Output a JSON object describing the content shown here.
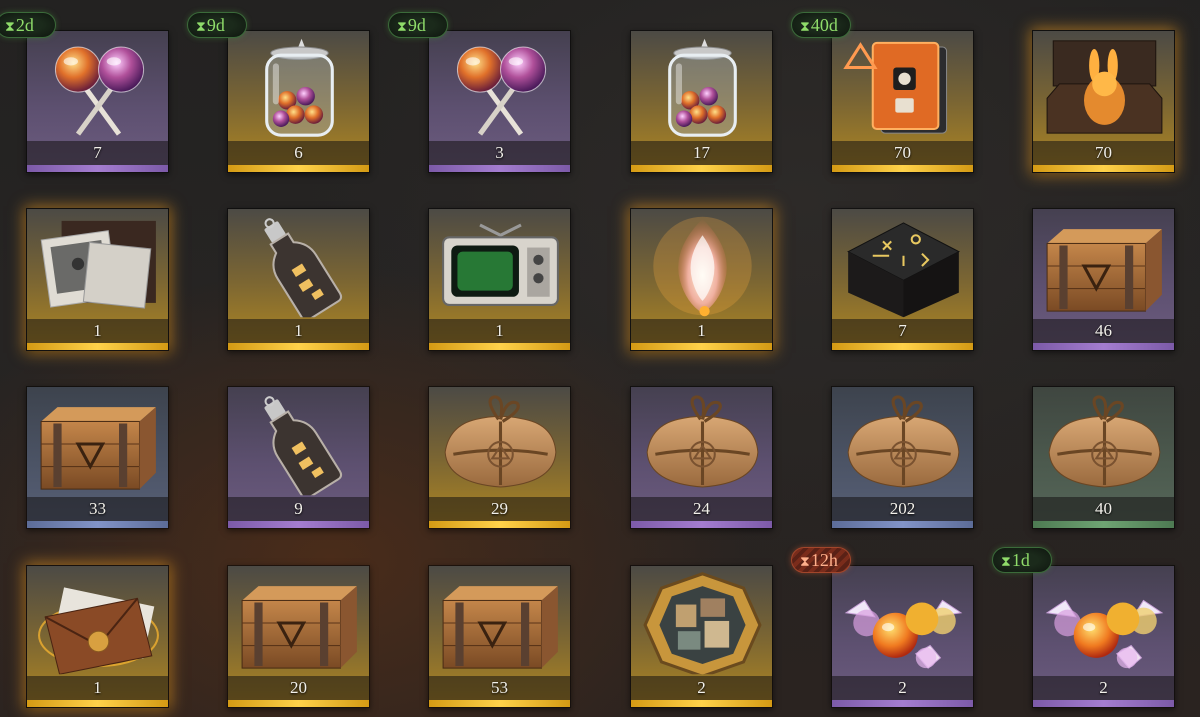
{
  "inventory": {
    "items": [
      {
        "quantity": "7",
        "rarity": "purple",
        "icon": "lollipop-pair-icon"
      },
      {
        "quantity": "6",
        "rarity": "gold",
        "icon": "candy-jar-icon",
        "timer": "9d"
      },
      {
        "quantity": "3",
        "rarity": "purple",
        "icon": "lollipop-pair-icon",
        "timer": "9d"
      },
      {
        "quantity": "17",
        "rarity": "gold",
        "icon": "candy-jar-icon"
      },
      {
        "quantity": "70",
        "rarity": "gold",
        "icon": "rune-tome-icon",
        "timer": "40d"
      },
      {
        "quantity": "70",
        "rarity": "gold",
        "icon": "rabbit-figurine-box-icon"
      },
      {
        "quantity": "1",
        "rarity": "gold",
        "icon": "photo-box-icon"
      },
      {
        "quantity": "1",
        "rarity": "gold",
        "icon": "message-bottle-icon"
      },
      {
        "quantity": "1",
        "rarity": "gold",
        "icon": "retro-tv-icon"
      },
      {
        "quantity": "1",
        "rarity": "gold",
        "icon": "spirit-flame-icon"
      },
      {
        "quantity": "7",
        "rarity": "gold",
        "icon": "rune-altar-icon"
      },
      {
        "quantity": "46",
        "rarity": "purple",
        "icon": "wooden-crate-icon"
      },
      {
        "quantity": "33",
        "rarity": "blue",
        "icon": "wooden-crate-icon"
      },
      {
        "quantity": "9",
        "rarity": "purple",
        "icon": "message-bottle-icon"
      },
      {
        "quantity": "29",
        "rarity": "gold",
        "icon": "paper-parcel-icon"
      },
      {
        "quantity": "24",
        "rarity": "purple",
        "icon": "paper-parcel-icon"
      },
      {
        "quantity": "202",
        "rarity": "blue",
        "icon": "paper-parcel-icon"
      },
      {
        "quantity": "40",
        "rarity": "green",
        "icon": "paper-parcel-icon"
      },
      {
        "quantity": "1",
        "rarity": "gold",
        "icon": "sealed-envelope-icon"
      },
      {
        "quantity": "20",
        "rarity": "gold",
        "icon": "wooden-crate-icon"
      },
      {
        "quantity": "53",
        "rarity": "gold",
        "icon": "wooden-crate-icon"
      },
      {
        "quantity": "2",
        "rarity": "gold",
        "icon": "puzzle-medallion-icon"
      },
      {
        "quantity": "2",
        "rarity": "purple",
        "icon": "wrapped-candy-icon",
        "timer": "12h",
        "timer_style": "expiring"
      },
      {
        "quantity": "2",
        "rarity": "purple",
        "icon": "wrapped-candy-icon",
        "timer": "1d"
      }
    ],
    "extra_timers": [
      {
        "timer": "2d"
      }
    ],
    "colors": {
      "purple": "#8f6cc0",
      "gold": "#f0b52a",
      "blue": "#7284b8",
      "green": "#5f9463",
      "timer_green": "#8fdc6a",
      "timer_red": "#ffb08c"
    }
  }
}
